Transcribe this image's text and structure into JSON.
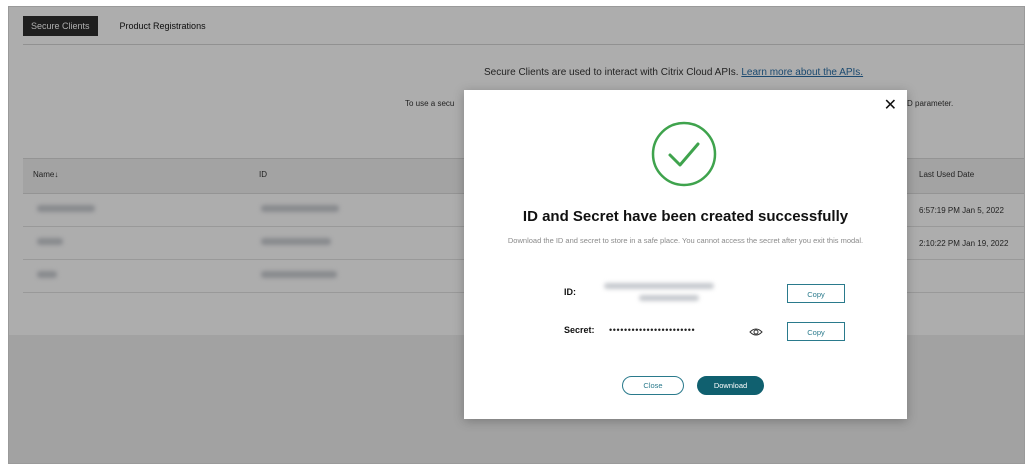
{
  "tabs": {
    "secure_clients": "Secure Clients",
    "product_registrations": "Product Registrations"
  },
  "info": {
    "line1_text": "Secure Clients are used to interact with Citrix Cloud APIs. ",
    "line1_link": "Learn more about the APIs.",
    "line2_left": "To use a secu",
    "line2_right": "D parameter."
  },
  "table": {
    "headers": {
      "name": "Name",
      "id": "ID",
      "last_used": "Last Used Date"
    },
    "sort_indicator": "↓",
    "rows": [
      {
        "last_used": "6:57:19 PM Jan 5, 2022"
      },
      {
        "last_used": "2:10:22 PM Jan 19, 2022"
      },
      {
        "last_used": ""
      }
    ]
  },
  "modal": {
    "close_glyph": "✕",
    "title": "ID and Secret have been created successfully",
    "subtitle": "Download the ID and secret to store in a safe place. You cannot access the secret after you exit this modal.",
    "id_label": "ID:",
    "secret_label": "Secret:",
    "secret_mask": "•••••••••••••••••••••••",
    "copy_label": "Copy",
    "close_button": "Close",
    "download_button": "Download"
  },
  "colors": {
    "accent": "#2a7a8c",
    "primary_button": "#10606f",
    "success_green": "#3fa34d",
    "link": "#2a6ea5"
  },
  "icons": {
    "check": "check-circle-icon",
    "eye": "eye-icon",
    "close": "close-icon",
    "sort": "arrow-down-icon"
  }
}
